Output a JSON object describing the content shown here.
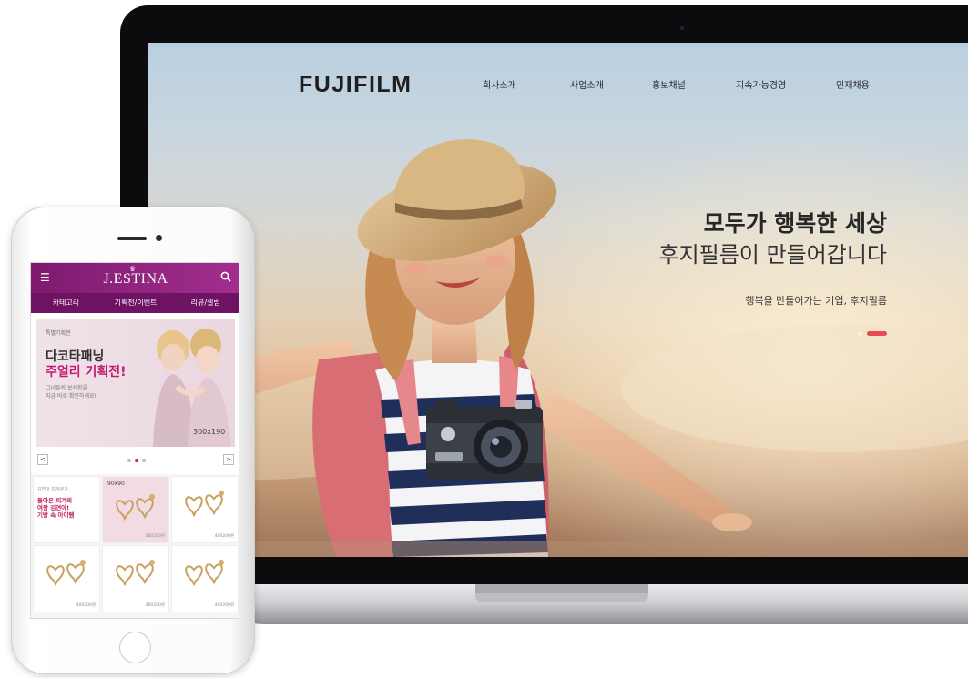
{
  "laptop": {
    "site": {
      "logo": "FUJIFILM",
      "nav": [
        "회사소개",
        "사업소개",
        "홍보채널",
        "지속가능경영",
        "인재채용"
      ],
      "hero": {
        "title": "모두가 행복한 세상",
        "subtitle": "후지필름이 만들어갑니다",
        "tagline": "행복을 만들어가는 기업, 후지필름",
        "slide_count": 2,
        "active_slide": 2
      }
    }
  },
  "phone": {
    "app": {
      "logo": "J.ESTINA",
      "tabs": [
        "카테고리",
        "기획전/이벤트",
        "리뷰/셀럽"
      ],
      "banner": {
        "eyebrow": "특별기획전",
        "title_line1": "다코타패닝",
        "title_line2": "주얼리 기획전!",
        "desc_line1": "그녀들의 보석함을",
        "desc_line2": "지금 바로 확인하세요!",
        "size_label": "300x190",
        "prev": "<",
        "next": ">",
        "dot_count": 3,
        "active_dot": 2
      },
      "grid": {
        "promo_eyebrow": "김연아 피겨퀸가",
        "promo_line1": "돌아온 피겨의",
        "promo_line2": "여왕 김연아!",
        "promo_line3": "기방 속 아이템",
        "tag": "90x90",
        "price": "400200원"
      }
    }
  },
  "colors": {
    "brand_purple": "#8a1f7c",
    "hero_accent": "#e84a54"
  },
  "icons": [
    "menu-icon",
    "search-icon",
    "crown-icon"
  ]
}
